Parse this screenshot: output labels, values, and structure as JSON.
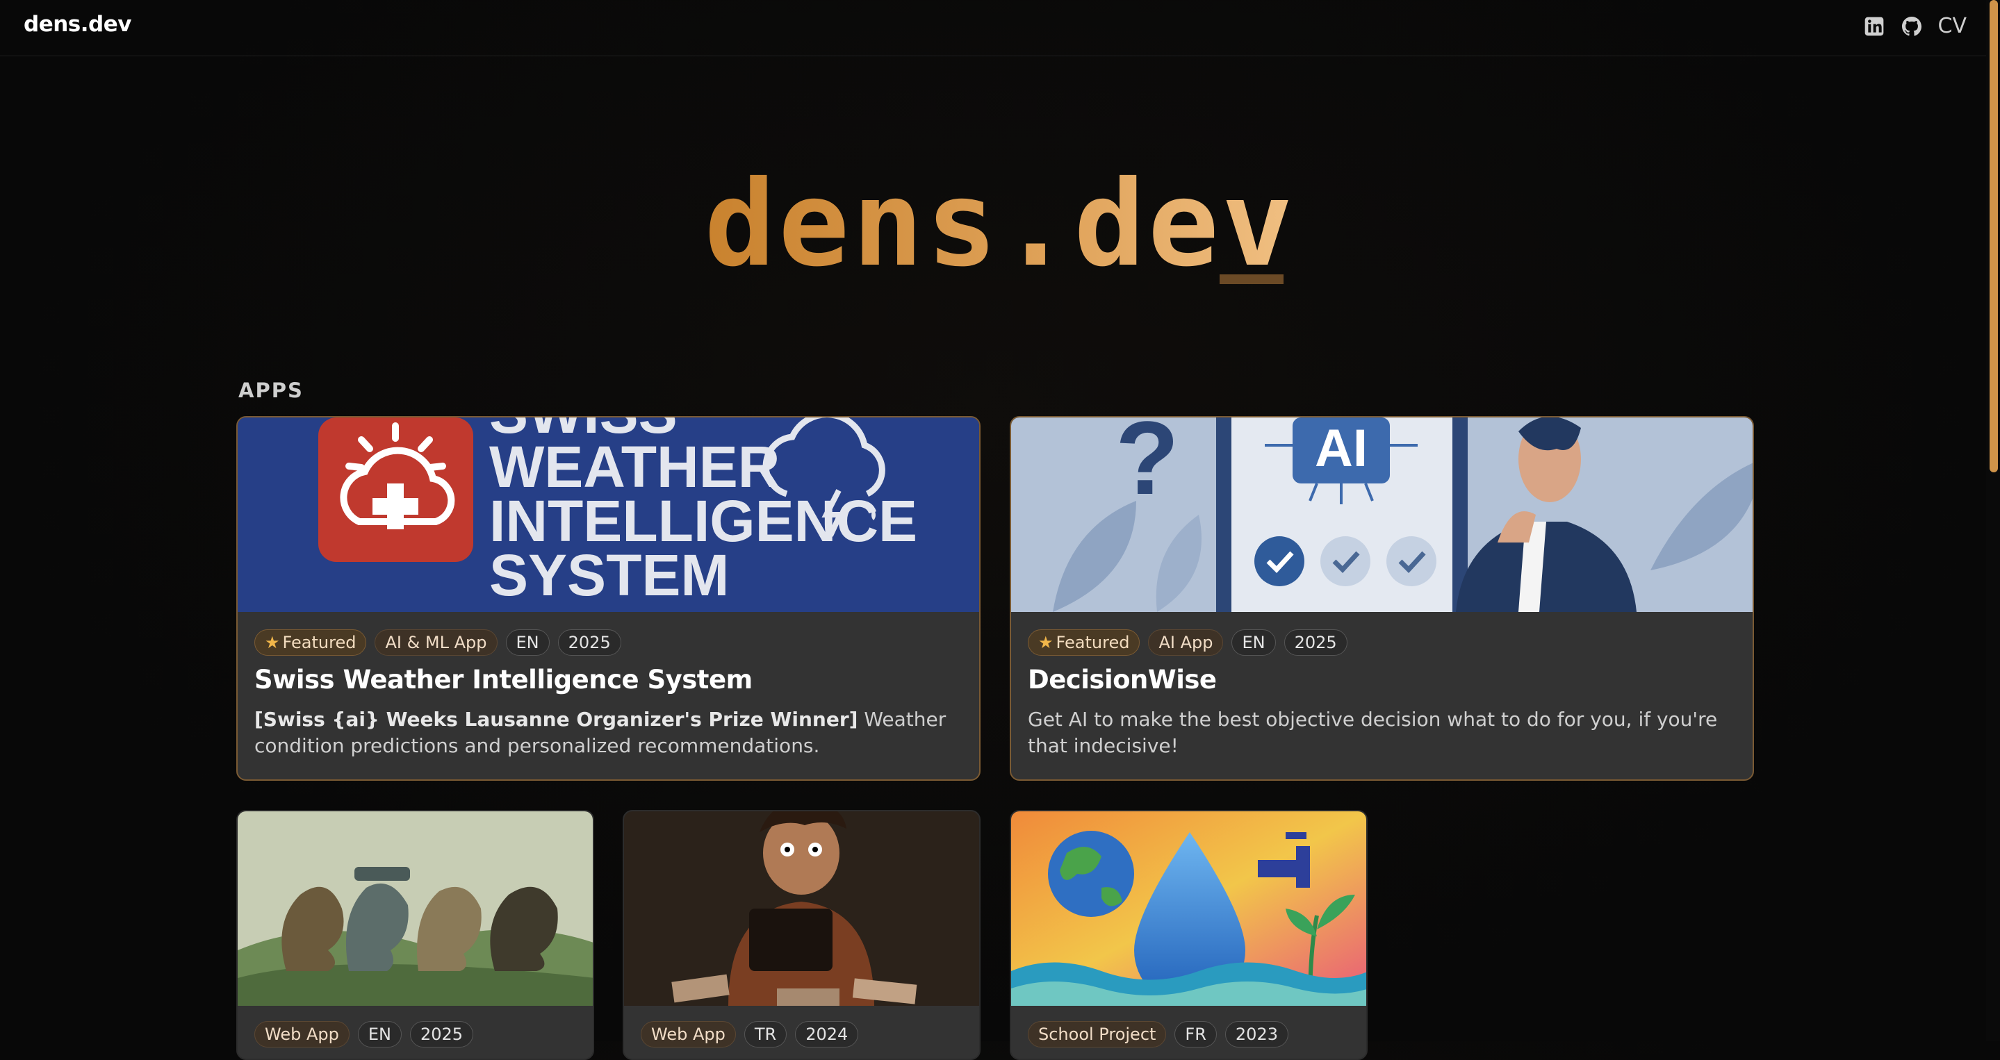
{
  "header": {
    "brand": "dens.dev",
    "cv_label": "CV",
    "icons": [
      "linkedin-icon",
      "github-icon"
    ]
  },
  "hero": {
    "title": "dens.dev"
  },
  "apps_section": {
    "title": "APPS"
  },
  "featured_cards": [
    {
      "tags": [
        "Featured",
        "AI & ML App",
        "EN",
        "2025"
      ],
      "title": "Swiss Weather Intelligence System",
      "desc_bold": "[Swiss {ai} Weeks Lausanne Organizer's Prize Winner]",
      "desc": " Weather condition predictions and personalized recommendations.",
      "image_text": [
        "SWISS",
        "WEATHER",
        "INTELLIGENCE",
        "SYSTEM"
      ]
    },
    {
      "tags": [
        "Featured",
        "AI App",
        "EN",
        "2025"
      ],
      "title": "DecisionWise",
      "desc": "Get AI to make the best objective decision what to do for you, if you're that indecisive!",
      "image_text": [
        "?",
        "AI"
      ]
    }
  ],
  "small_cards": [
    {
      "tags": [
        "Web App",
        "EN",
        "2025"
      ]
    },
    {
      "tags": [
        "Web App",
        "TR",
        "2024"
      ]
    },
    {
      "tags": [
        "School Project",
        "FR",
        "2023"
      ]
    }
  ],
  "colors": {
    "accent": "#d89a4e",
    "card_bg": "#333333",
    "page_bg": "#080808"
  }
}
